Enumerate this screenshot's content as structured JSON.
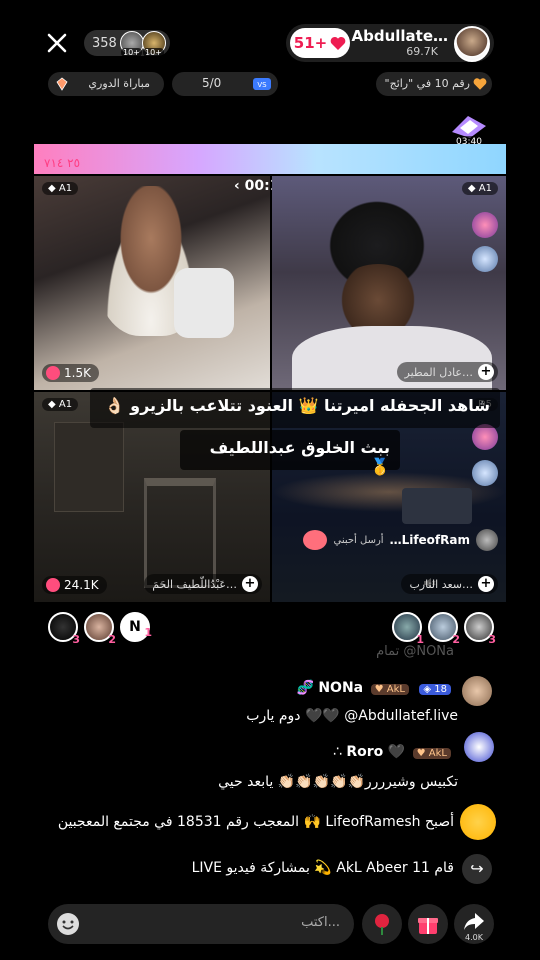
{
  "header": {
    "viewer_count": "358",
    "viewer_badges": [
      "10+",
      "10+"
    ],
    "host_name": "Abdullate…",
    "host_likes": "69.7K",
    "follow_label": "51+"
  },
  "subbar": {
    "league_label": "مباراة الدوري",
    "match_score": "5/0",
    "rank_label": "رقم 10 في \"رائج\"",
    "timer_chip": "03:40"
  },
  "grid": {
    "top_number": "٢٥ ٧١٤",
    "timer": "00:19",
    "cells": [
      {
        "badge": "A1",
        "count": "1.5K"
      },
      {
        "badge": "A1",
        "name": "عادل المطير…"
      },
      {
        "badge": "A1",
        "count": "24.1K",
        "name": "عَبْدُاللّطيف الحَمَ…"
      },
      {
        "badge": "D5",
        "name": "سعد التارب…",
        "guest_name": "LifeofRam…",
        "guest_tag": "أرسل أحبني"
      }
    ]
  },
  "overlay": {
    "line1": "شاهد الجحفله اميرتنا 👑 العنود تتلاعب بالزيرو 👌🏻",
    "line2": "ببث الخلوق عبداللطيف 🥇"
  },
  "ranking": {
    "left": [
      {
        "num": "3"
      },
      {
        "num": "2"
      },
      {
        "num": "1",
        "letter": "N"
      }
    ],
    "right": [
      {
        "num": "1"
      },
      {
        "num": "2"
      },
      {
        "num": "3"
      }
    ]
  },
  "chat": {
    "faded": "NONa@ تمام",
    "msg1_user": "NONa",
    "msg1_level": "18",
    "msg1_badge": "AkL",
    "msg1_text": "Abdullatef.live@ 🖤🖤 دوم يارب",
    "msg2_user": "Roro",
    "msg2_badge": "AkL",
    "msg2_text": "تكبيس وشيرررر👏🏻👏🏻👏🏻👏🏻👏🏻 يابعد حيي",
    "msg3_text": "أصبح LifeofRamesh 🙌 المعجب رقم 18531 في مجتمع المعجبين",
    "msg4_text": "قام 11 AkL Abeer 💫 بمشاركة فيديو LIVE"
  },
  "bottom": {
    "comment_placeholder": "اكتب...",
    "share_count": "4.0K"
  }
}
